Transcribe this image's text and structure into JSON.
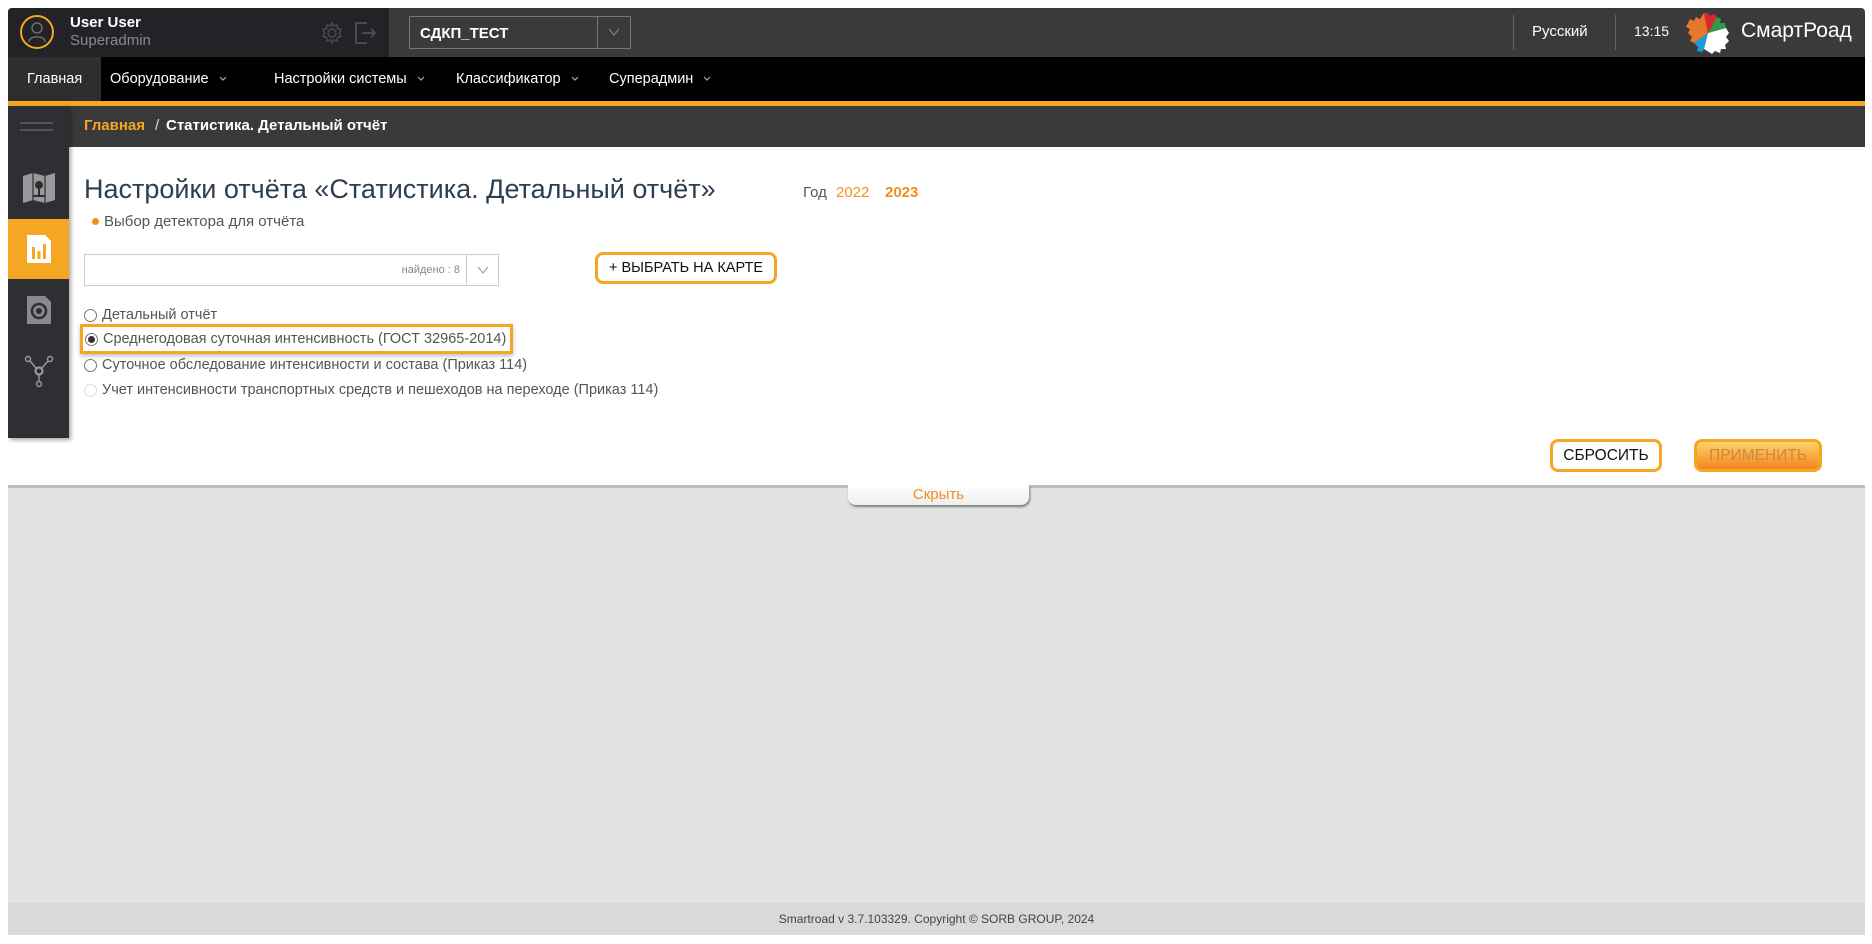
{
  "header": {
    "user_name": "User User",
    "user_role": "Superadmin",
    "company_select": {
      "value": "СДКП_ТЕСТ"
    },
    "language": "Русский",
    "time": "13:15",
    "brand": "СмартРоад",
    "icons": [
      "user-icon",
      "gear-icon",
      "logout-icon",
      "chevron-down-icon",
      "logo-gear-icon"
    ],
    "logo_colors": [
      "#e8772e",
      "#d9282f",
      "#2e9a47",
      "#1a9cd8",
      "#ffffff"
    ]
  },
  "nav": {
    "items": [
      {
        "label": "Главная",
        "active": true,
        "dropdown": false
      },
      {
        "label": "Оборудование",
        "active": false,
        "dropdown": true
      },
      {
        "label": "Настройки системы",
        "active": false,
        "dropdown": true
      },
      {
        "label": "Классификатор",
        "active": false,
        "dropdown": true
      },
      {
        "label": "Суперадмин",
        "active": false,
        "dropdown": true
      }
    ]
  },
  "sidebar": {
    "items": [
      {
        "icon": "map-icon",
        "active": false
      },
      {
        "icon": "report-chart-icon",
        "active": true
      },
      {
        "icon": "detector-icon",
        "active": false
      },
      {
        "icon": "network-icon",
        "active": false
      }
    ]
  },
  "breadcrumb": {
    "home": "Главная",
    "separator": "/",
    "current": "Статистика. Детальный отчёт"
  },
  "panel": {
    "title": "Настройки отчёта «Статистика. Детальный отчёт»",
    "year_label": "Год",
    "years": [
      {
        "label": "2022",
        "selected": false
      },
      {
        "label": "2023",
        "selected": true
      }
    ],
    "detector_label": "Выбор детектора для отчёта",
    "detector_select": {
      "value": "",
      "found_text": "найдено : 8"
    },
    "map_button": "+ ВЫБРАТЬ НА КАРТЕ",
    "report_types": [
      {
        "label": "Детальный отчёт",
        "checked": false,
        "disabled": false
      },
      {
        "label": "Среднегодовая суточная интенсивность (ГОСТ 32965-2014)",
        "checked": true,
        "disabled": false
      },
      {
        "label": "Суточное обследование интенсивности и состава (Приказ 114)",
        "checked": false,
        "disabled": false
      },
      {
        "label": "Учет интенсивности транспортных средств и пешеходов на переходе (Приказ 114)",
        "checked": false,
        "disabled": true
      }
    ],
    "reset_button": "СБРОСИТЬ",
    "apply_button": "ПРИМЕНИТЬ",
    "hide_tab": "Скрыть"
  },
  "colors": {
    "accent": "#f5a623",
    "link": "#f18e1c",
    "header_bg": "#3a3a3a",
    "nav_bg": "#000000",
    "sidebar_bg": "#2e2f35"
  },
  "footer": {
    "text": "Smartroad v 3.7.103329. Copyright © SORB GROUP, 2024"
  }
}
